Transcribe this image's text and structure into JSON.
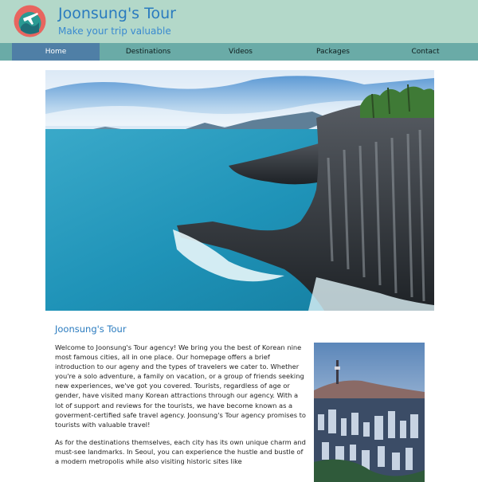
{
  "header": {
    "title": "Joonsung's Tour",
    "tagline": "Make your trip valuable",
    "logo_icon": "airplane-globe-logo"
  },
  "nav": {
    "items": [
      {
        "label": "Home",
        "active": true
      },
      {
        "label": "Destinations",
        "active": false
      },
      {
        "label": "Videos",
        "active": false
      },
      {
        "label": "Packages",
        "active": false
      },
      {
        "label": "Contact",
        "active": false
      }
    ]
  },
  "main": {
    "heading": "Joonsung's Tour",
    "paragraphs": [
      "Welcome to Joonsung's Tour agency! We bring you the best of Korean nine most famous cities, all in one place. Our homepage offers a brief introduction to our ageny and the types of travelers we cater to. Whether you're a solo adventure, a family on vacation, or a group of friends seeking new experiences, we've got you covered. Tourists, regardless of age or gender, have visited many Korean attractions through our agency. With a lot of support and reviews for the tourists, we have become known as a goverment-certified safe travel agency. Joonsung's Tour agency promises to tourists with valuable travel!",
      "As for the destinations themselves, each city has its own unique charm and must-see landmarks. In Seoul, you can experience the hustle and bustle of a modern metropolis while also visiting historic sites like"
    ]
  },
  "colors": {
    "header_bg": "#b3d8c9",
    "nav_bg": "#6aaba7",
    "nav_active": "#4f7fa6",
    "title_blue": "#2a7bbf"
  }
}
